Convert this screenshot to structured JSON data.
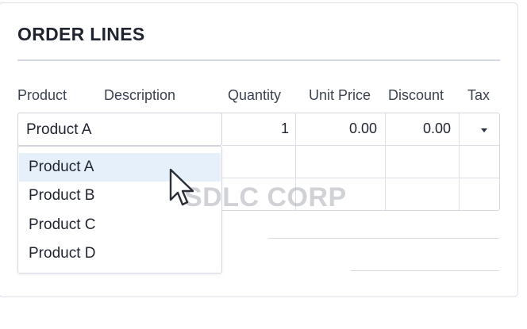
{
  "section": {
    "title": "ORDER LINES"
  },
  "columns": {
    "product": "Product",
    "description": "Description",
    "quantity": "Quantity",
    "unit_price": "Unit Price",
    "discount": "Discount",
    "tax": "Tax"
  },
  "line": {
    "product": "Product A",
    "quantity": "1",
    "unit_price": "0.00",
    "discount": "0.00"
  },
  "dropdown": {
    "options": [
      "Product A",
      "Product B",
      "Product C",
      "Product D"
    ],
    "highlighted": "Product A"
  },
  "watermark": "SDLC CORP",
  "colors": {
    "highlight": "#e6f0fb",
    "border": "#d4d8e0",
    "text": "#1f2430"
  },
  "icons": {
    "tax_dropdown": "caret-down-icon",
    "pointer": "mouse-pointer-icon"
  }
}
